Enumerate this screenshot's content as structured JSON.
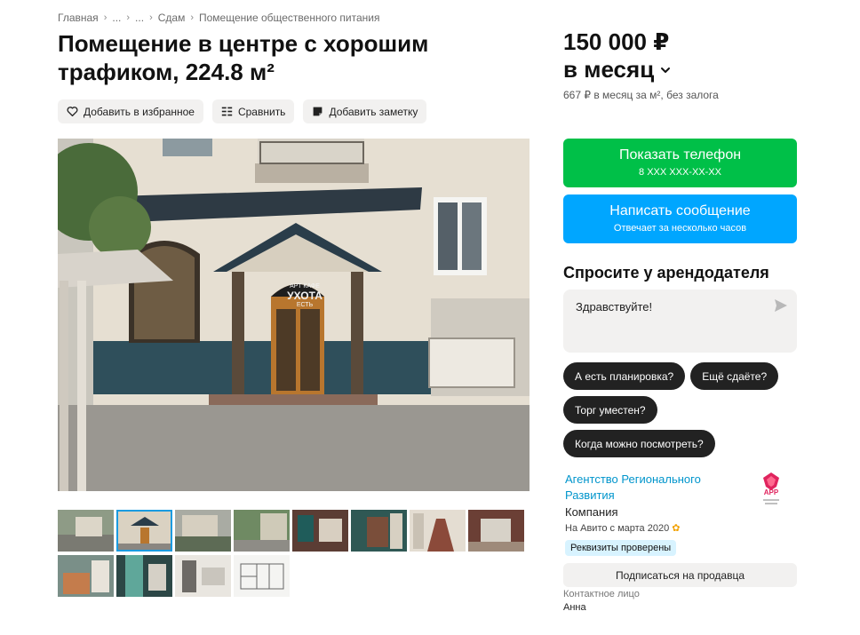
{
  "breadcrumbs": {
    "items": [
      "Главная",
      "...",
      "...",
      "Сдам",
      "Помещение общественного питания"
    ]
  },
  "listing": {
    "title": "Помещение в центре с хорошим трафиком, 224.8 м²",
    "price_line1": "150 000 ₽",
    "price_line2": "в месяц",
    "price_sub": "667 ₽ в месяц за м², без залога"
  },
  "actions": {
    "favorite": "Добавить в избранное",
    "compare": "Сравнить",
    "note": "Добавить заметку"
  },
  "gallery": {
    "main_photo_sign_line1": "АРТ КАФЕ",
    "main_photo_sign_line2": "УХОТА",
    "main_photo_sign_small": "ЕСТЬ",
    "thumbnails_count": 12,
    "active_index": 1
  },
  "contact": {
    "phone_button": "Показать телефон",
    "phone_mask": "8 XXX XXX-XX-XX",
    "message_button": "Написать сообщение",
    "message_sub": "Отвечает за несколько часов"
  },
  "ask": {
    "title": "Спросите у арендодателя",
    "input_value": "Здравствуйте!",
    "chips": [
      "А есть планировка?",
      "Ещё сдаёте?",
      "Торг уместен?",
      "Когда можно посмотреть?"
    ]
  },
  "seller": {
    "name": "Агентство Регионального Развития",
    "logo_text": "АРР",
    "type": "Компания",
    "since": "На Авито с марта 2020",
    "verified_badge": "Реквизиты проверены",
    "subscribe_button": "Подписаться на продавца",
    "contact_label": "Контактное лицо",
    "contact_name": "Анна"
  },
  "colors": {
    "green": "#00c048",
    "blue": "#00a6ff",
    "link": "#0095cc",
    "chip": "#222222"
  }
}
